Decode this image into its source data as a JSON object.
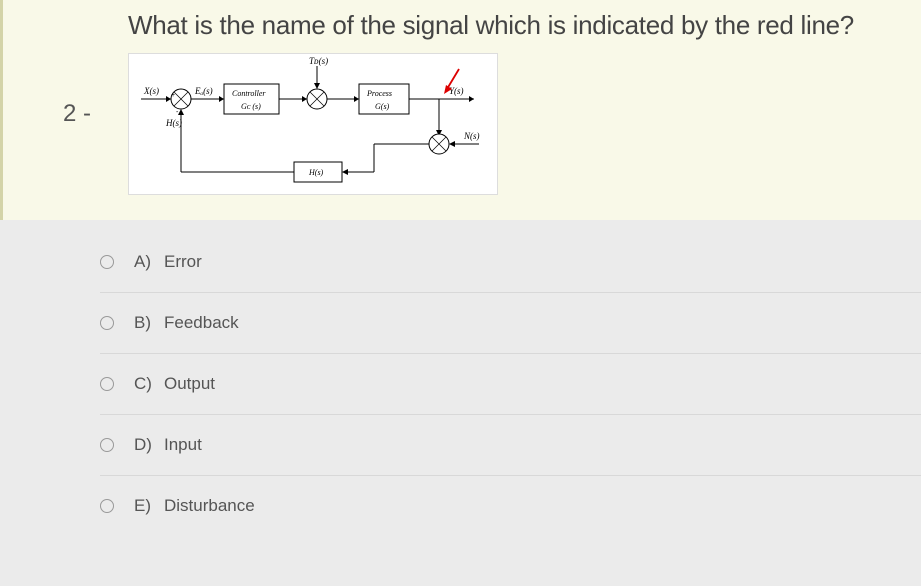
{
  "question_number": "2 -",
  "question_text": "What is the name of the signal which is indicated by the red line?",
  "diagram": {
    "labels": {
      "input": "X(s)",
      "error": "Eₐ(s)",
      "controller_title": "Controller",
      "controller_tf": "Gᴄ (s)",
      "disturbance": "Tᴅ(s)",
      "process_title": "Process",
      "process_tf": "G(s)",
      "output": "Y(s)",
      "noise": "N(s)",
      "feedback": "H(s)",
      "h_label": "H(s)"
    }
  },
  "options": [
    {
      "letter": "A)",
      "text": "Error"
    },
    {
      "letter": "B)",
      "text": "Feedback"
    },
    {
      "letter": "C)",
      "text": "Output"
    },
    {
      "letter": "D)",
      "text": "Input"
    },
    {
      "letter": "E)",
      "text": "Disturbance"
    }
  ]
}
